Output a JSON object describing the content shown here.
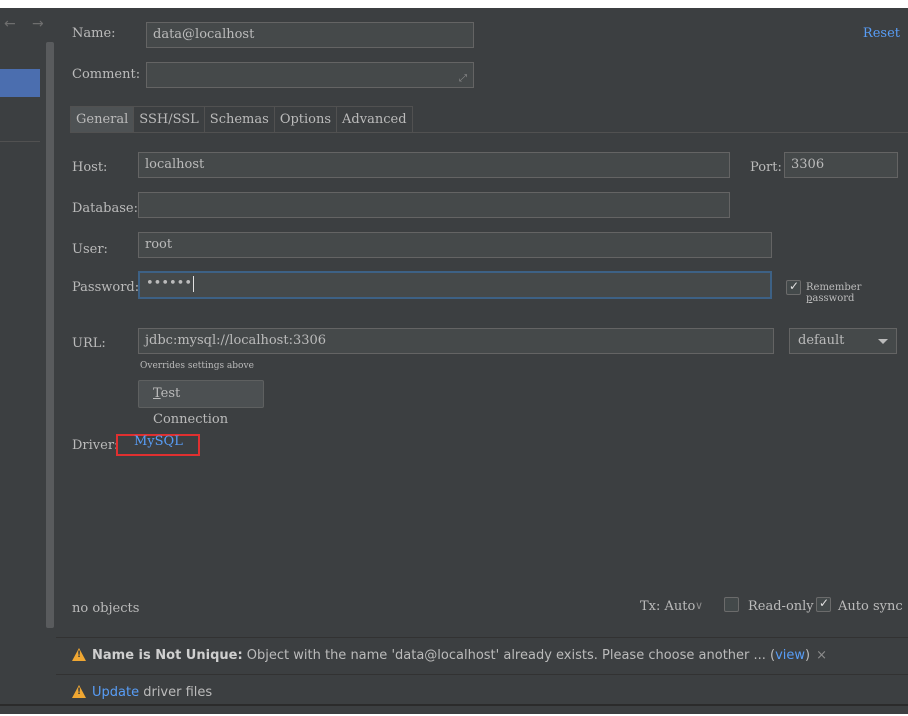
{
  "nav": {
    "back_icon": "←",
    "forward_icon": "→"
  },
  "header": {
    "name_label": "Name:",
    "name_value": "data@localhost",
    "comment_label": "Comment:",
    "comment_value": "",
    "reset": "Reset"
  },
  "tabs": [
    {
      "label": "General",
      "active": true
    },
    {
      "label": "SSH/SSL"
    },
    {
      "label": "Schemas"
    },
    {
      "label": "Options"
    },
    {
      "label": "Advanced"
    }
  ],
  "general": {
    "host_label": "Host:",
    "host_value": "localhost",
    "port_label": "Port:",
    "port_value": "3306",
    "database_label": "Database:",
    "database_value": "",
    "user_label": "User:",
    "user_value": "root",
    "password_label": "Password:",
    "password_value": "••••••",
    "remember_label_pre": "Remember ",
    "remember_label_mn": "p",
    "remember_label_post": "assword",
    "url_label": "URL:",
    "url_value": "jdbc:mysql://localhost:3306",
    "url_hint": "Overrides settings above",
    "url_mode": "default",
    "test_mn": "T",
    "test_rest": "est Connection",
    "driver_label": "Driver:",
    "driver_value": "MySQL"
  },
  "footer": {
    "objects": "no objects",
    "tx": "Tx: Auto",
    "tx_chevron": "∨",
    "readonly": "Read-only",
    "autosync": "Auto sync"
  },
  "warning": {
    "title": "Name is Not Unique:",
    "message": " Object with the name 'data@localhost' already exists. Please choose another ... (",
    "view": "view",
    "close_paren": ")",
    "close": "×"
  },
  "update": {
    "link": "Update",
    "text": " driver files"
  },
  "colors": {
    "accent": "#589df6",
    "warning": "#f0a732",
    "highlight_box": "#e03030",
    "selection": "#4b6eaf"
  }
}
